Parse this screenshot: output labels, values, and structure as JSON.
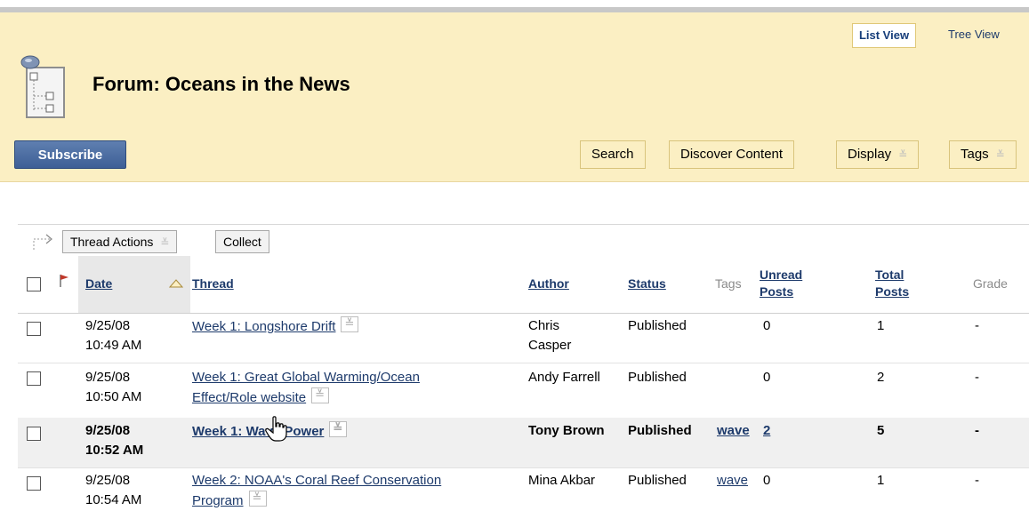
{
  "header": {
    "view_tabs": [
      "List View",
      "Tree View"
    ],
    "title": "Forum: Oceans in the News",
    "subscribe": "Subscribe",
    "buttons": [
      "Search",
      "Discover Content",
      "Display",
      "Tags"
    ]
  },
  "actions": {
    "thread_actions": "Thread Actions",
    "collect": "Collect"
  },
  "table": {
    "headers": {
      "date": "Date",
      "thread": "Thread",
      "author": "Author",
      "status": "Status",
      "tags": "Tags",
      "unread": "Unread Posts",
      "total": "Total Posts",
      "grade": "Grade"
    },
    "rows": [
      {
        "date": "9/25/08",
        "time": "10:49 AM",
        "thread_a": "Week 1: Longshore Drift",
        "thread_b": "",
        "author_a": "Chris",
        "author_b": "Casper",
        "status": "Published",
        "tags": "",
        "unread": "0",
        "total": "1",
        "grade": "-"
      },
      {
        "date": "9/25/08",
        "time": "10:50 AM",
        "thread_a": "Week 1: Great Global Warming/Ocean",
        "thread_b": "Effect/Role website",
        "author_a": "Andy Farrell",
        "author_b": "",
        "status": "Published",
        "tags": "",
        "unread": "0",
        "total": "2",
        "grade": "-"
      },
      {
        "date": "9/25/08",
        "time": "10:52 AM",
        "thread_a": "Week 1: Wave Power",
        "thread_b": "",
        "author_a": "Tony Brown",
        "author_b": "",
        "status": "Published",
        "tags": "wave",
        "unread": "2",
        "total": "5",
        "grade": "-"
      },
      {
        "date": "9/25/08",
        "time": "10:54 AM",
        "thread_a": "Week 2: NOAA's Coral Reef Conservation",
        "thread_b": "Program",
        "author_a": "Mina Akbar",
        "author_b": "",
        "status": "Published",
        "tags": "wave",
        "unread": "0",
        "total": "1",
        "grade": "-"
      }
    ]
  }
}
